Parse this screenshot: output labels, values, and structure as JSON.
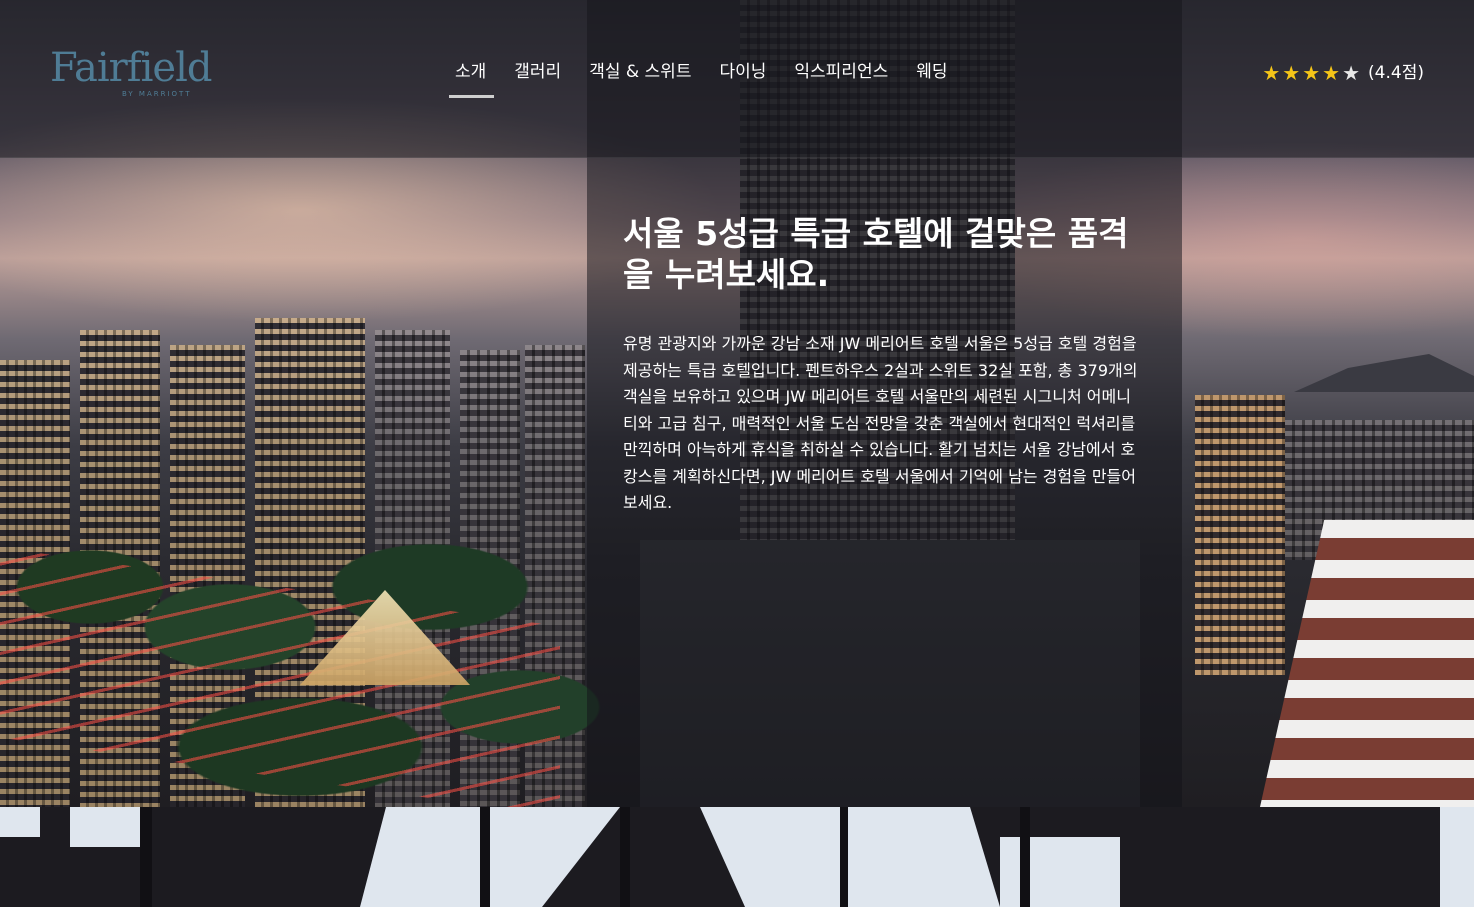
{
  "header": {
    "logo": {
      "brand": "Fairfield",
      "sub": "BY MARRIOTT"
    },
    "nav": [
      {
        "label": "소개",
        "active": true
      },
      {
        "label": "갤러리",
        "active": false
      },
      {
        "label": "객실 & 스위트",
        "active": false
      },
      {
        "label": "다이닝",
        "active": false
      },
      {
        "label": "익스피리언스",
        "active": false
      },
      {
        "label": "웨딩",
        "active": false
      }
    ],
    "rating": {
      "stars": 4.4,
      "text": "(4.4점)",
      "star_color": "#f5c518"
    }
  },
  "hero": {
    "title": "서울 5성급 특급 호텔에 걸맞은 품격을 누려보세요.",
    "body": "유명 관광지와 가까운 강남 소재 JW 메리어트 호텔 서울은 5성급 호텔 경험을 제공하는 특급 호텔입니다. 펜트하우스 2실과 스위트 32실 포함, 총 379개의 객실을 보유하고 있으며 JW 메리어트 호텔 서울만의 세련된 시그니처 어메니티와 고급 침구, 매력적인 서울 도심 전망을 갖춘 객실에서 현대적인 럭셔리를 만끽하며 아늑하게 휴식을 취하실 수 있습니다. 활기 넘치는 서울 강남에서 호캉스를 계획하신다면, JW 메리어트 호텔 서울에서 기억에 남는 경험을 만들어 보세요."
  },
  "colors": {
    "logo": "#4f7c95",
    "panel_overlay": "rgba(20,20,24,0.52)"
  }
}
